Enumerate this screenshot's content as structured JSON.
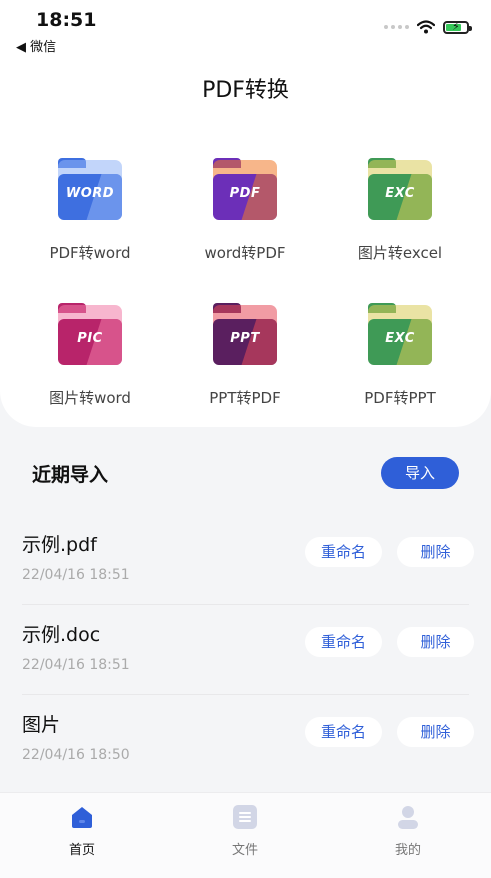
{
  "status_bar": {
    "time": "18:51",
    "back_label": "◀ 微信"
  },
  "header": {
    "title": "PDF转换"
  },
  "tools": [
    {
      "icon_text": "WORD",
      "label": "PDF转word",
      "icon": "word-folder-icon",
      "colors": [
        "#3e6fe0",
        "#8fb2f5"
      ]
    },
    {
      "icon_text": "PDF",
      "label": "word转PDF",
      "icon": "pdf-folder-icon",
      "colors": [
        "#6c2fb8",
        "#f07a2a"
      ]
    },
    {
      "icon_text": "EXC",
      "label": "图片转excel",
      "icon": "excel-folder-icon",
      "colors": [
        "#3f9a56",
        "#d8cc5a"
      ]
    },
    {
      "icon_text": "PIC",
      "label": "图片转word",
      "icon": "pic-folder-icon",
      "colors": [
        "#b8246a",
        "#f07aa6"
      ]
    },
    {
      "icon_text": "PPT",
      "label": "PPT转PDF",
      "icon": "ppt-folder-icon",
      "colors": [
        "#5a1f5f",
        "#e64a5a"
      ]
    },
    {
      "icon_text": "EXC",
      "label": "PDF转PPT",
      "icon": "excel-folder-icon",
      "colors": [
        "#3f9a56",
        "#d8cc5a"
      ]
    }
  ],
  "recent": {
    "title": "近期导入",
    "import_label": "导入",
    "rename_label": "重命名",
    "delete_label": "删除",
    "files": [
      {
        "name": "示例.pdf",
        "time": "22/04/16 18:51"
      },
      {
        "name": "示例.doc",
        "time": "22/04/16 18:51"
      },
      {
        "name": "图片",
        "time": "22/04/16 18:50"
      }
    ]
  },
  "tab_bar": {
    "items": [
      {
        "label": "首页",
        "icon": "home-icon",
        "active": true
      },
      {
        "label": "文件",
        "icon": "file-icon",
        "active": false
      },
      {
        "label": "我的",
        "icon": "profile-icon",
        "active": false
      }
    ]
  },
  "colors": {
    "accent": "#2f5fd8",
    "background": "#f4f5f7",
    "card": "#ffffff"
  }
}
